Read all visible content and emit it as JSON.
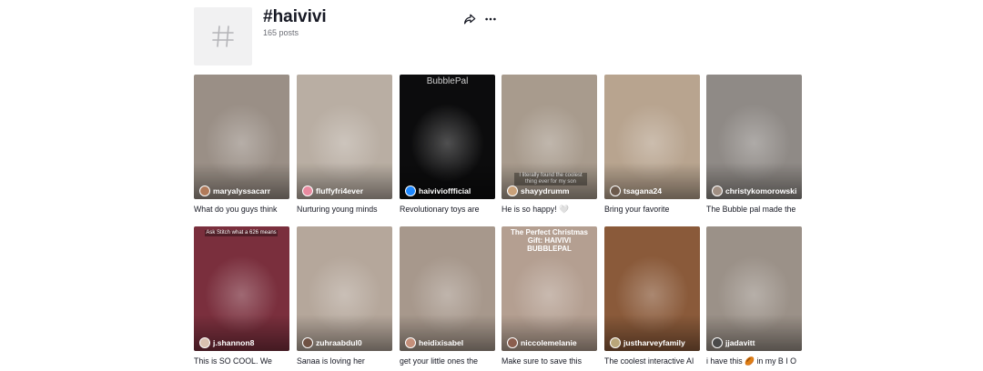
{
  "header": {
    "title": "#haivivi",
    "post_count": "165 posts",
    "share_icon": "share-icon",
    "more_icon": "more-icon"
  },
  "videos": [
    {
      "username": "maryalyssacarr",
      "caption": "What do you guys think",
      "bg": "#9a8f86",
      "avatar": "#b07a5a"
    },
    {
      "username": "fluffyfri4ever",
      "caption": "Nurturing young minds",
      "bg": "#b9aea3",
      "avatar": "#e98aa0"
    },
    {
      "username": "haivivioffficial",
      "caption": "Revolutionary toys are",
      "bg": "#0c0c0d",
      "avatar": "#1e88ff",
      "overlay": "BubblePal"
    },
    {
      "username": "shayydrumm",
      "caption": "He is so happy! 🤍",
      "bg": "#a89b8d",
      "avatar": "#caa27a",
      "overlay": "I literally found the coolest thing ever for my son"
    },
    {
      "username": "tsagana24",
      "caption": "Bring your favorite",
      "bg": "#b8a48f",
      "avatar": "#6c5a4c"
    },
    {
      "username": "christykomorowski",
      "caption": "The Bubble pal made the",
      "bg": "#8f8a86",
      "avatar": "#a08f83"
    },
    {
      "username": "j.shannon8",
      "caption": "This is SO COOL. We",
      "bg": "#7a2f3d",
      "avatar": "#d9c1b0",
      "overlay": "Ask Stitch what a 626 means"
    },
    {
      "username": "zuhraabdul0",
      "caption": "Sanaa is loving her",
      "bg": "#b5a79b",
      "avatar": "#6f5244"
    },
    {
      "username": "heidixisabel",
      "caption": "get your little ones the",
      "bg": "#a7988c",
      "avatar": "#c48f7a"
    },
    {
      "username": "niccolemelanie",
      "caption": "Make sure to save this",
      "bg": "#b49f91",
      "avatar": "#8b5e4e",
      "overlay": "The Perfect Christmas Gift: HAIVIVI BUBBLEPAL"
    },
    {
      "username": "justharveyfamily",
      "caption": "The coolest interactive AI",
      "bg": "#8a5a3a",
      "avatar": "#b9a67a"
    },
    {
      "username": "jjadavitt",
      "caption": "i have this 🏉 in my B I O",
      "bg": "#9b9188",
      "avatar": "#4a4a4a"
    }
  ]
}
